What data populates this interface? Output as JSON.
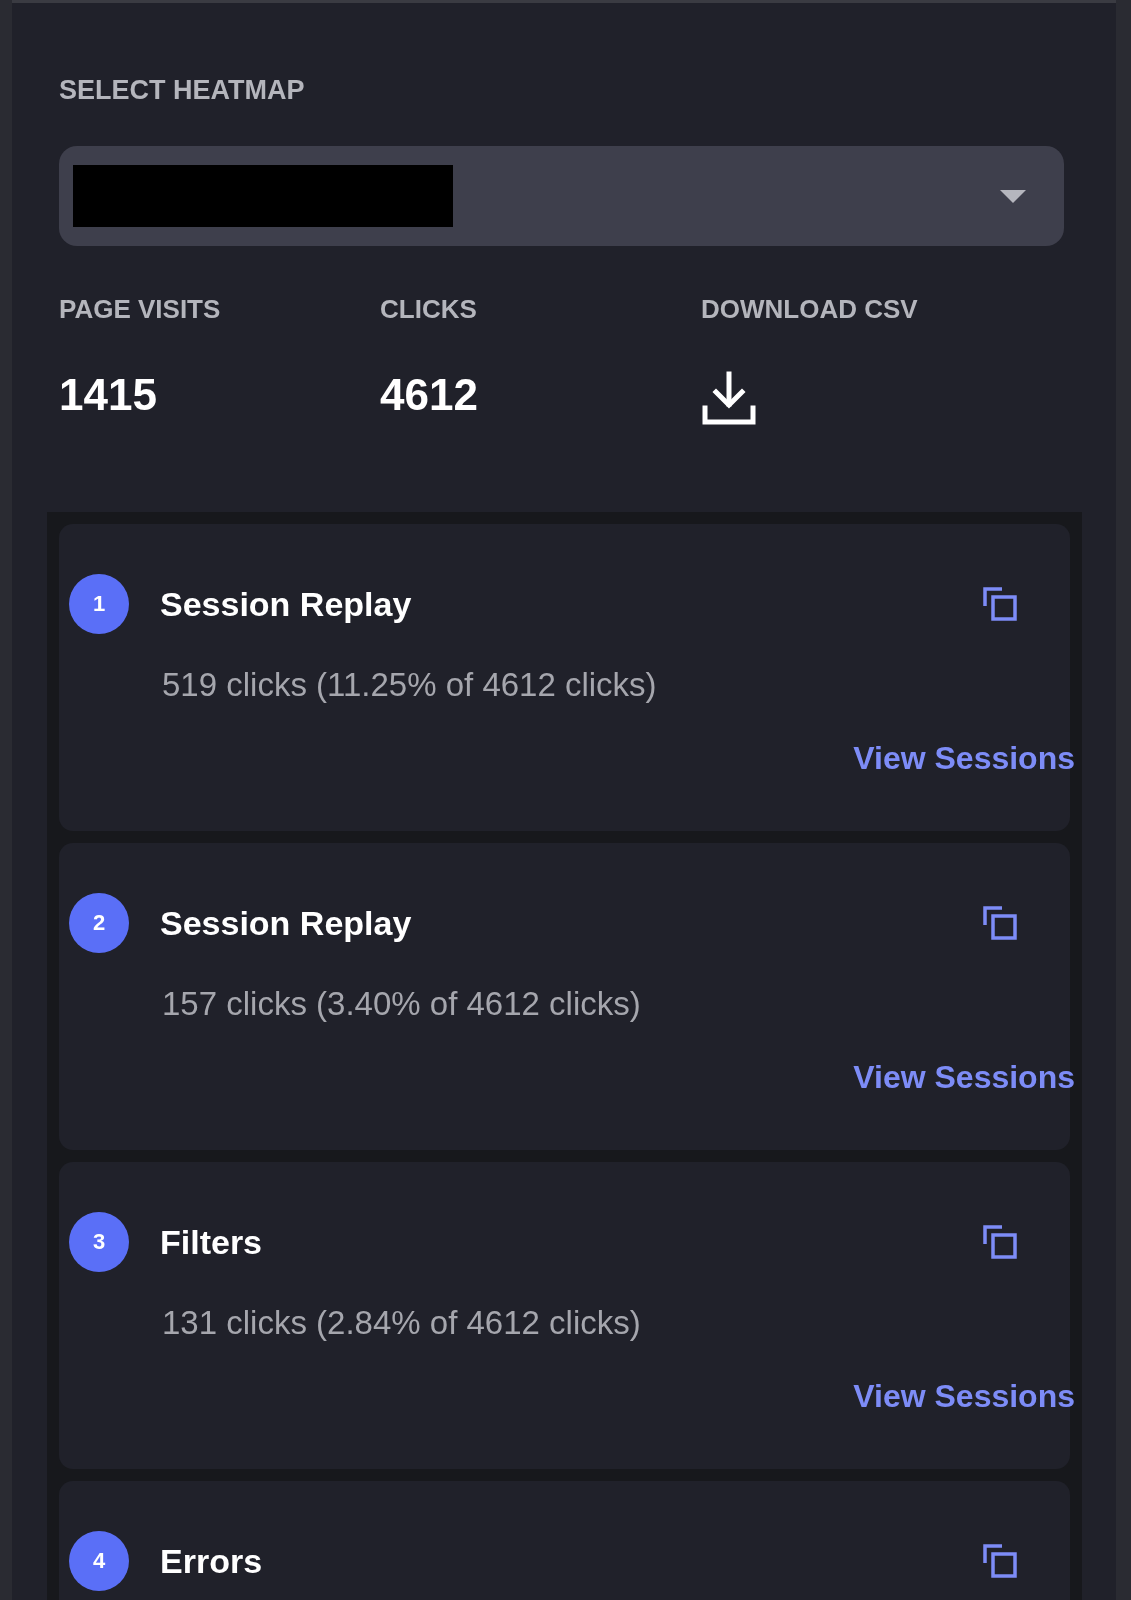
{
  "heading": "SELECT HEATMAP",
  "stats": [
    {
      "label": "PAGE VISITS",
      "value": "1415",
      "kind": "number"
    },
    {
      "label": "CLICKS",
      "value": "4612",
      "kind": "number"
    },
    {
      "label": "DOWNLOAD CSV",
      "kind": "download"
    }
  ],
  "items": [
    {
      "rank": "1",
      "title": "Session Replay",
      "detail": "519 clicks (11.25% of 4612 clicks)",
      "link": "View Sessions"
    },
    {
      "rank": "2",
      "title": "Session Replay",
      "detail": "157 clicks (3.40% of 4612 clicks)",
      "link": "View Sessions"
    },
    {
      "rank": "3",
      "title": "Filters",
      "detail": "131 clicks (2.84% of 4612 clicks)",
      "link": "View Sessions"
    },
    {
      "rank": "4",
      "title": "Errors"
    }
  ]
}
